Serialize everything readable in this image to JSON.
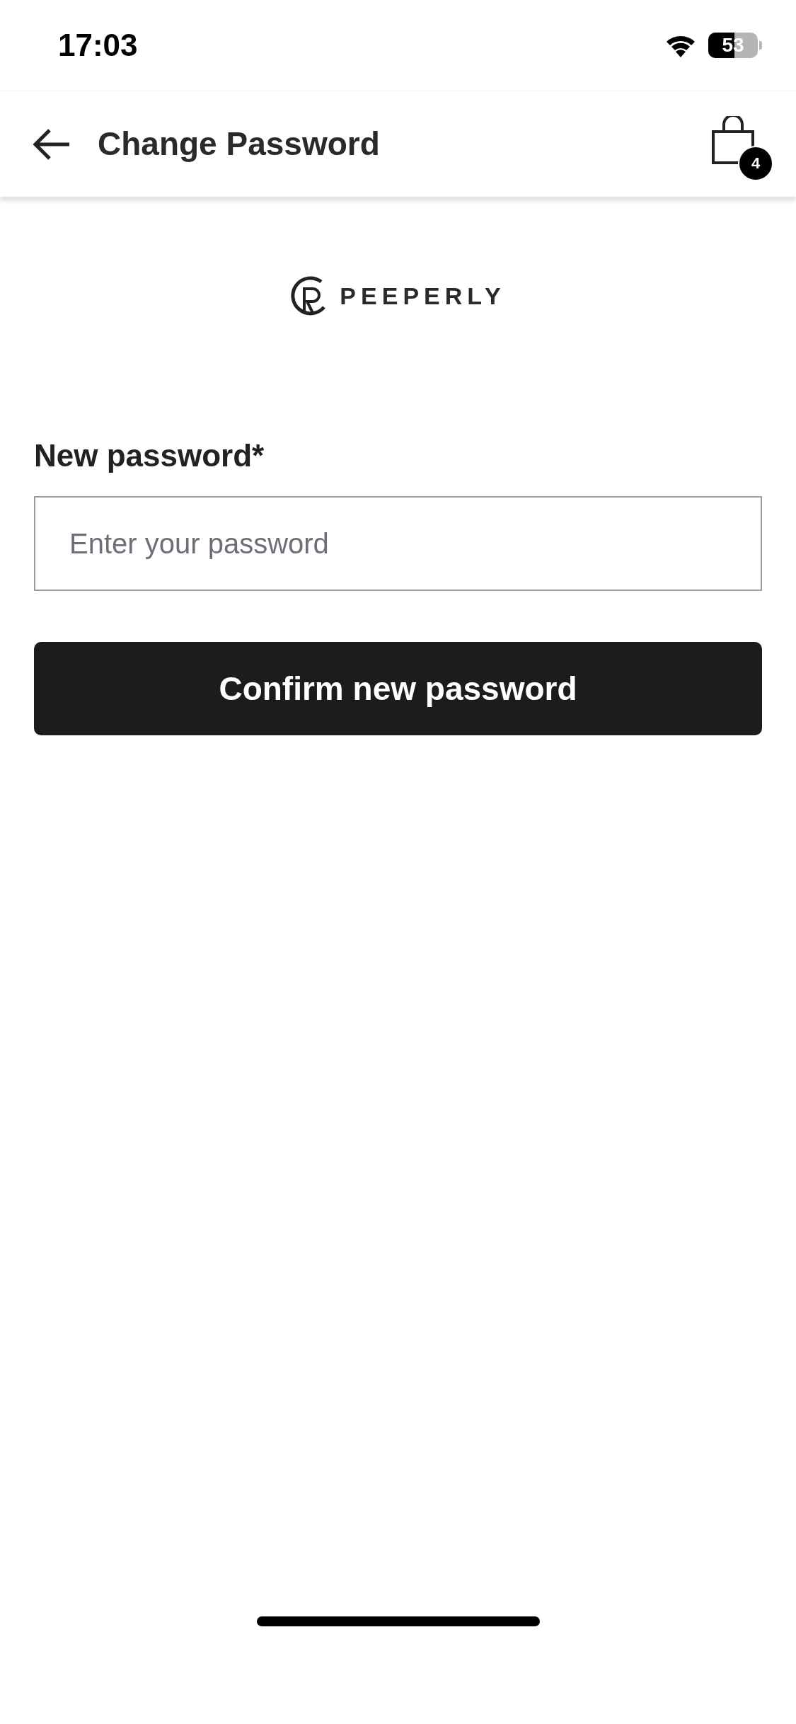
{
  "status_bar": {
    "time": "17:03",
    "battery": "53"
  },
  "header": {
    "title": "Change Password",
    "cart_count": "4"
  },
  "logo": {
    "text": "PEEPERLY"
  },
  "form": {
    "label": "New password*",
    "field": {
      "placeholder": "Enter your password"
    },
    "button": "Confirm new password"
  }
}
